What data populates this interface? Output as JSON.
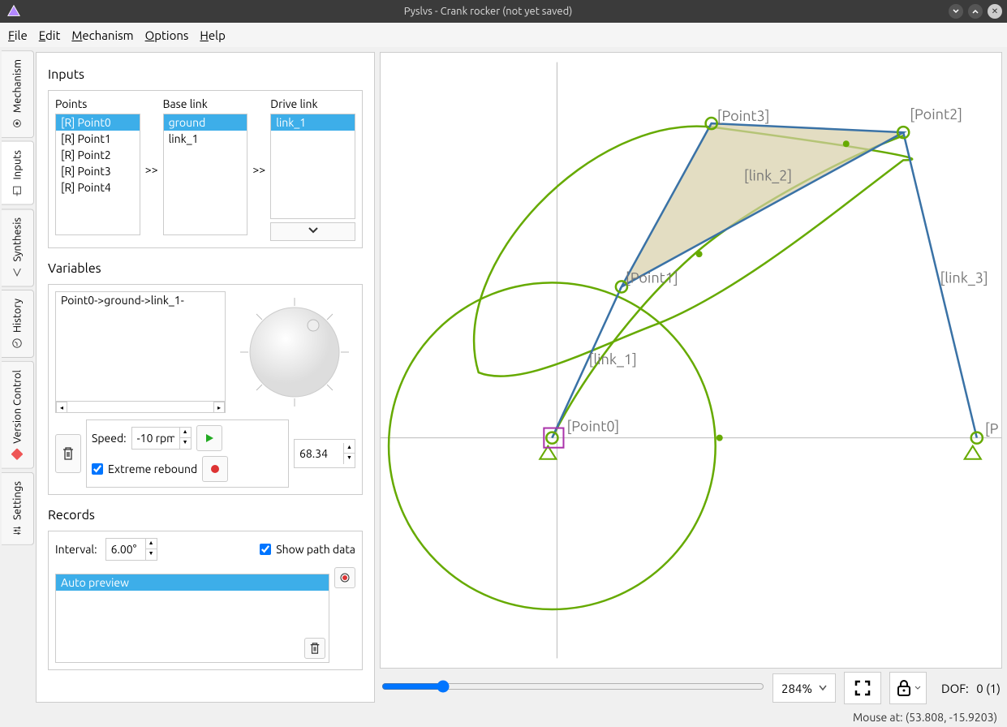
{
  "window": {
    "title": "Pyslvs - Crank rocker (not yet saved)"
  },
  "menu": {
    "file": "File",
    "edit": "Edit",
    "mechanism": "Mechanism",
    "options": "Options",
    "help": "Help"
  },
  "side_tabs": {
    "mechanism": "Mechanism",
    "inputs": "Inputs",
    "synthesis": "Synthesis",
    "history": "History",
    "version_control": "Version Control",
    "settings": "Settings"
  },
  "inputs_panel": {
    "title": "Inputs",
    "points_label": "Points",
    "baselink_label": "Base link",
    "drivelink_label": "Drive link",
    "points": [
      "[R] Point0",
      "[R] Point1",
      "[R] Point2",
      "[R] Point3",
      "[R] Point4"
    ],
    "points_selected": 0,
    "base_links": [
      "ground",
      "link_1"
    ],
    "base_selected": 0,
    "drive_links": [
      "link_1"
    ],
    "drive_selected": 0,
    "arrow": ">>"
  },
  "variables": {
    "title": "Variables",
    "items": [
      "Point0->ground->link_1-"
    ],
    "speed_label": "Speed:",
    "speed_value": "-10 rpm",
    "angle_value": "68.34",
    "extreme_rebound": "Extreme rebound",
    "extreme_checked": true
  },
  "records": {
    "title": "Records",
    "interval_label": "Interval:",
    "interval_value": "6.00°",
    "show_path_label": "Show path data",
    "show_path_checked": true,
    "items": [
      "Auto preview"
    ],
    "selected": 0
  },
  "canvas": {
    "labels": {
      "point0": "[Point0]",
      "point1": "[Point1]",
      "point2": "[Point2]",
      "point3": "[Point3]",
      "link1": "[link_1]",
      "link2": "[link_2]",
      "link3": "[link_3]",
      "pointP": "[P"
    }
  },
  "footer": {
    "zoom": "284%",
    "dof_label": "DOF:",
    "dof_value": "0 (1)"
  },
  "status": {
    "mouse": "Mouse at: (53.808, -15.9203)"
  },
  "icons": {
    "play": "play",
    "record_stop": "stop",
    "record": "record",
    "trash": "trash",
    "expand": "expand",
    "lock": "lock",
    "chevron_down": "chevron-down"
  }
}
